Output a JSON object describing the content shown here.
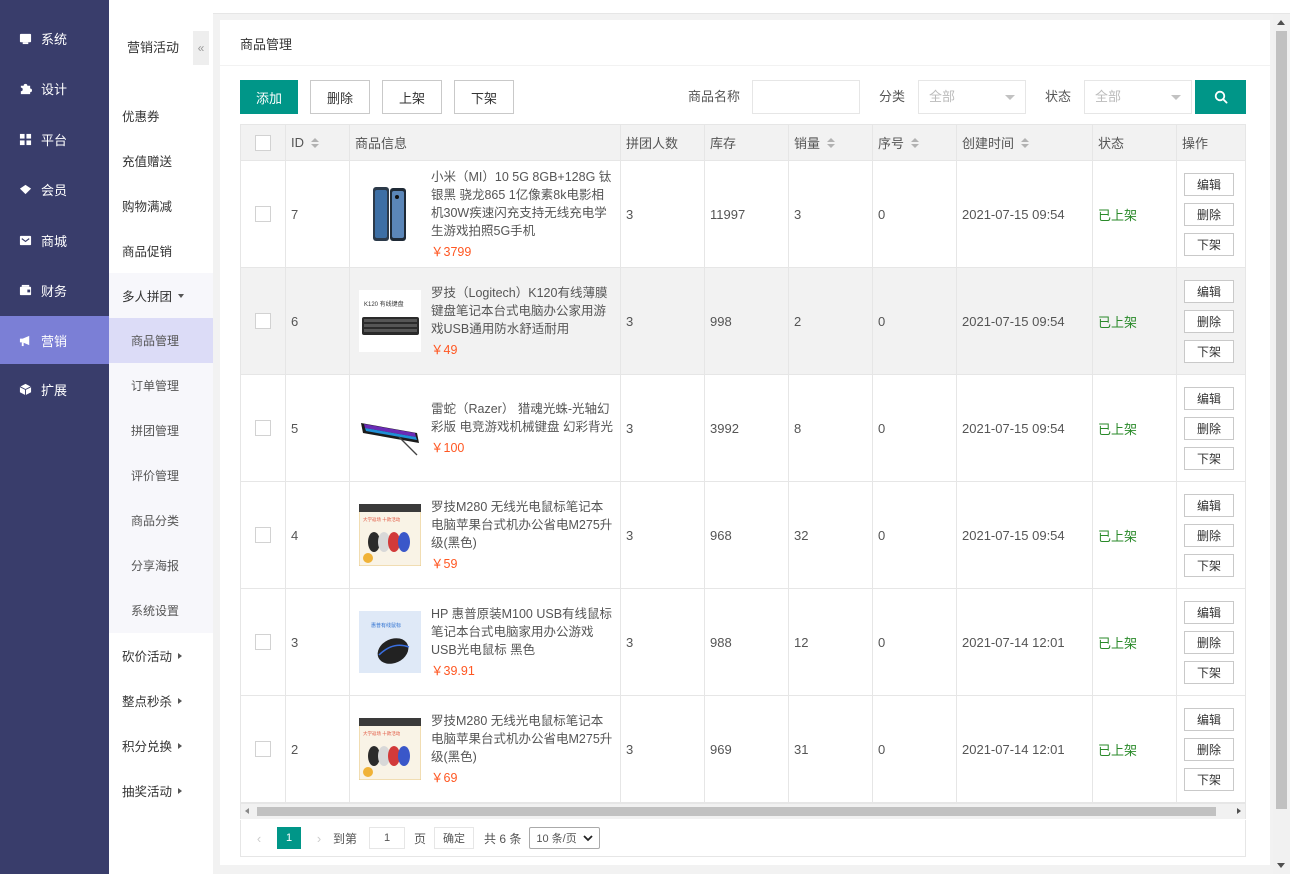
{
  "main_nav": [
    {
      "label": "系统",
      "icon": "system-icon",
      "active": false
    },
    {
      "label": "设计",
      "icon": "puzzle-icon",
      "active": false
    },
    {
      "label": "平台",
      "icon": "grid-icon",
      "active": false
    },
    {
      "label": "会员",
      "icon": "member-icon",
      "active": false
    },
    {
      "label": "商城",
      "icon": "mail-icon",
      "active": false
    },
    {
      "label": "财务",
      "icon": "wallet-icon",
      "active": false
    },
    {
      "label": "营销",
      "icon": "megaphone-icon",
      "active": true
    },
    {
      "label": "扩展",
      "icon": "cube-icon",
      "active": false
    }
  ],
  "sub_nav": {
    "title": "营销活动",
    "collapse_label": "«",
    "items": [
      {
        "label": "优惠券"
      },
      {
        "label": "充值赠送"
      },
      {
        "label": "购物满减"
      },
      {
        "label": "商品促销"
      }
    ],
    "group": {
      "label": "多人拼团",
      "children": [
        {
          "label": "商品管理",
          "active": true
        },
        {
          "label": "订单管理"
        },
        {
          "label": "拼团管理"
        },
        {
          "label": "评价管理"
        },
        {
          "label": "商品分类"
        },
        {
          "label": "分享海报"
        },
        {
          "label": "系统设置"
        }
      ]
    },
    "more": [
      {
        "label": "砍价活动"
      },
      {
        "label": "整点秒杀"
      },
      {
        "label": "积分兑换"
      },
      {
        "label": "抽奖活动"
      }
    ]
  },
  "page": {
    "title": "商品管理"
  },
  "toolbar": {
    "add": "添加",
    "delete": "删除",
    "list_on": "上架",
    "list_off": "下架",
    "name_label": "商品名称",
    "name_value": "",
    "category_label": "分类",
    "category_value": "全部",
    "status_label": "状态",
    "status_value": "全部"
  },
  "table": {
    "columns": [
      "ID",
      "商品信息",
      "拼团人数",
      "库存",
      "销量",
      "序号",
      "创建时间",
      "状态",
      "操作"
    ],
    "rows": [
      {
        "id": "7",
        "name": "小米（MI）10 5G 8GB+128G 钛银黑 骁龙865 1亿像素8k电影相机30W疾速闪充支持无线充电学生游戏拍照5G手机",
        "price": "￥3799",
        "group_size": "3",
        "stock": "11997",
        "sales": "3",
        "sort": "0",
        "created": "2021-07-15 09:54",
        "status": "已上架",
        "thumb": "phone"
      },
      {
        "id": "6",
        "name": "罗技（Logitech）K120有线薄膜键盘笔记本台式电脑办公家用游戏USB通用防水舒适耐用",
        "price": "￥49",
        "group_size": "3",
        "stock": "998",
        "sales": "2",
        "sort": "0",
        "created": "2021-07-15 09:54",
        "status": "已上架",
        "thumb": "keyboard"
      },
      {
        "id": "5",
        "name": "雷蛇（Razer） 猎魂光蛛-光轴幻彩版 电竞游戏机械键盘 幻彩背光",
        "price": "￥100",
        "group_size": "3",
        "stock": "3992",
        "sales": "8",
        "sort": "0",
        "created": "2021-07-15 09:54",
        "status": "已上架",
        "thumb": "rgbkeyboard"
      },
      {
        "id": "4",
        "name": "罗技M280 无线光电鼠标笔记本电脑苹果台式机办公省电M275升级(黑色)",
        "price": "￥59",
        "group_size": "3",
        "stock": "968",
        "sales": "32",
        "sort": "0",
        "created": "2021-07-15 09:54",
        "status": "已上架",
        "thumb": "mice"
      },
      {
        "id": "3",
        "name": "HP 惠普原装M100 USB有线鼠标 笔记本台式电脑家用办公游戏USB光电鼠标 黑色",
        "price": "￥39.91",
        "group_size": "3",
        "stock": "988",
        "sales": "12",
        "sort": "0",
        "created": "2021-07-14 12:01",
        "status": "已上架",
        "thumb": "hpmouse"
      },
      {
        "id": "2",
        "name": "罗技M280 无线光电鼠标笔记本电脑苹果台式机办公省电M275升级(黑色)",
        "price": "￥69",
        "group_size": "3",
        "stock": "969",
        "sales": "31",
        "sort": "0",
        "created": "2021-07-14 12:01",
        "status": "已上架",
        "thumb": "mice"
      }
    ],
    "actions": {
      "edit": "编辑",
      "delete": "删除",
      "off": "下架"
    }
  },
  "pager": {
    "prev": "‹",
    "current": "1",
    "next": "›",
    "goto_label": "到第",
    "goto_value": "1",
    "page_unit": "页",
    "confirm": "确定",
    "total": "共 6 条",
    "page_size": "10 条/页"
  },
  "colors": {
    "nav_bg": "#393d6b",
    "nav_active": "#7b7fd6",
    "primary": "#009688",
    "price": "#ff5722",
    "status_on": "#2a8a2a"
  }
}
